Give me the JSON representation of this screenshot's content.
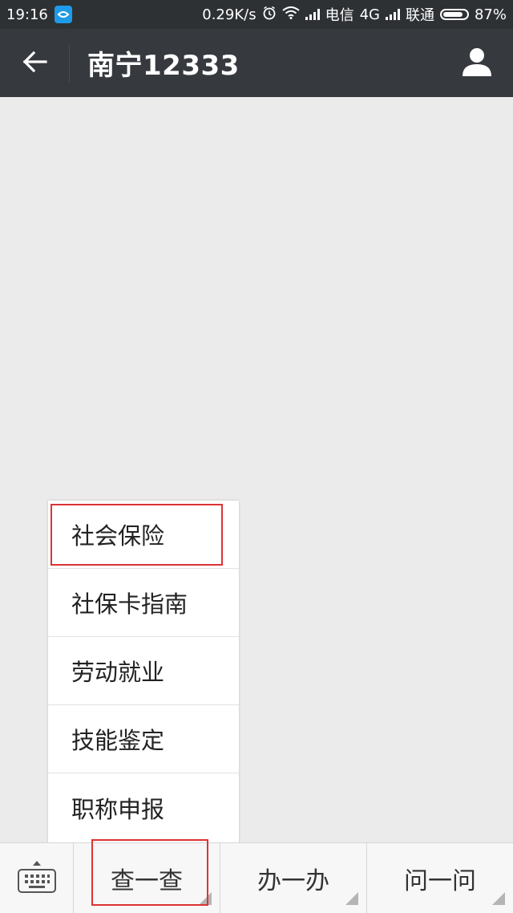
{
  "status_bar": {
    "time": "19:16",
    "speed": "0.29K/s",
    "carrier1": "电信",
    "network1": "4G",
    "carrier2": "联通",
    "battery": "87%"
  },
  "title_bar": {
    "title": "南宁12333"
  },
  "popup_menu": {
    "items": [
      {
        "label": "社会保险"
      },
      {
        "label": "社保卡指南"
      },
      {
        "label": "劳动就业"
      },
      {
        "label": "技能鉴定"
      },
      {
        "label": "职称申报"
      }
    ]
  },
  "bottom_menu": {
    "buttons": [
      {
        "label": "查一查"
      },
      {
        "label": "办一办"
      },
      {
        "label": "问一问"
      }
    ]
  },
  "colors": {
    "status_bar_bg": "#2e3134",
    "title_bar_bg": "#36393d",
    "highlight": "#dd3333",
    "chat_bg": "#ebebeb"
  },
  "icons": [
    "app-notification-icon",
    "alarm-icon",
    "wifi-icon",
    "signal-icon",
    "battery-icon",
    "back-arrow-icon",
    "profile-icon",
    "keyboard-icon"
  ]
}
